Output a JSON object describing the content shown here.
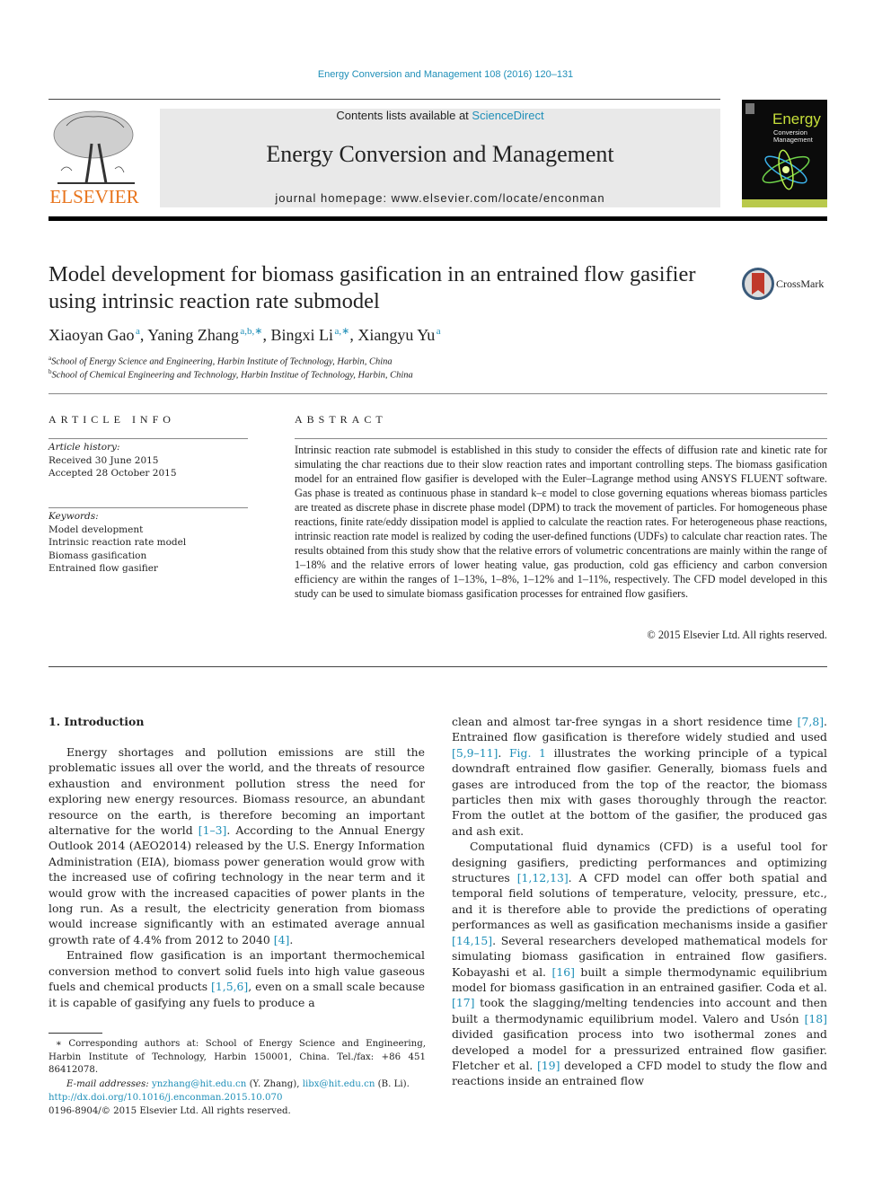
{
  "header": {
    "running_head": "Energy Conversion and Management 108 (2016) 120–131",
    "publisher_logo_text": "ELSEVIER",
    "contents_prefix": "Contents lists available at ",
    "contents_link": "ScienceDirect",
    "journal_title": "Energy Conversion and Management",
    "homepage": "journal homepage: www.elsevier.com/locate/enconman",
    "cover": {
      "line1": "Energy",
      "line2": "Conversion",
      "line3": "Management"
    },
    "crossmark_label": "CrossMark"
  },
  "article": {
    "title": "Model development for biomass gasification in an entrained flow gasifier using intrinsic reaction rate submodel",
    "authors": [
      {
        "name": "Xiaoyan Gao",
        "sup": "a"
      },
      {
        "name": "Yaning Zhang",
        "sup": "a,b,∗"
      },
      {
        "name": "Bingxi Li",
        "sup": "a,∗"
      },
      {
        "name": "Xiangyu Yu",
        "sup": "a"
      }
    ],
    "affiliations": [
      {
        "sup": "a",
        "text": "School of Energy Science and Engineering, Harbin Institute of Technology, Harbin, China"
      },
      {
        "sup": "b",
        "text": "School of Chemical Engineering and Technology, Harbin Institue of Technology, Harbin, China"
      }
    ]
  },
  "article_info": {
    "heading": "ARTICLE INFO",
    "history_label": "Article history:",
    "received": "Received 30 June 2015",
    "accepted": "Accepted 28 October 2015",
    "keywords_label": "Keywords:",
    "keywords": [
      "Model development",
      "Intrinsic reaction rate model",
      "Biomass gasification",
      "Entrained flow gasifier"
    ]
  },
  "abstract": {
    "heading": "ABSTRACT",
    "text": "Intrinsic reaction rate submodel is established in this study to consider the effects of diffusion rate and kinetic rate for simulating the char reactions due to their slow reaction rates and important controlling steps. The biomass gasification model for an entrained flow gasifier is developed with the Euler–Lagrange method using ANSYS FLUENT software. Gas phase is treated as continuous phase in standard k–ε model to close governing equations whereas biomass particles are treated as discrete phase in discrete phase model (DPM) to track the movement of particles. For homogeneous phase reactions, finite rate/eddy dissipation model is applied to calculate the reaction rates. For heterogeneous phase reactions, intrinsic reaction rate model is realized by coding the user-defined functions (UDFs) to calculate char reaction rates. The results obtained from this study show that the relative errors of volumetric concentrations are mainly within the range of 1–18% and the relative errors of lower heating value, gas production, cold gas efficiency and carbon conversion efficiency are within the ranges of 1–13%, 1–8%, 1–12% and 1–11%, respectively. The CFD model developed in this study can be used to simulate biomass gasification processes for entrained flow gasifiers.",
    "copyright": "© 2015 Elsevier Ltd. All rights reserved."
  },
  "intro": {
    "heading": "1. Introduction",
    "left": [
      {
        "t": "Energy shortages and pollution emissions are still the problematic issues all over the world, and the threats of resource exhaustion and environment pollution stress the need for exploring new energy resources. Biomass resource, an abundant resource on the earth, is therefore becoming an important alternative for the world "
      },
      {
        "ref": "[1–3]"
      },
      {
        "t": ". According to the Annual Energy Outlook 2014 (AEO2014) released by the U.S. Energy Information Administration (EIA), biomass power generation would grow with the increased use of cofiring technology in the near term and it would grow with the increased capacities of power plants in the long run. As a result, the electricity generation from biomass would increase significantly with an estimated average annual growth rate of 4.4% from 2012 to 2040 "
      },
      {
        "ref": "[4]"
      },
      {
        "t": "."
      }
    ],
    "left_p2": [
      {
        "t": "Entrained flow gasification is an important thermochemical conversion method to convert solid fuels into high value gaseous fuels and chemical products "
      },
      {
        "ref": "[1,5,6]"
      },
      {
        "t": ", even on a small scale because it is capable of gasifying any fuels to produce a"
      }
    ],
    "right_p1": [
      {
        "t": "clean and almost tar-free syngas in a short residence time "
      },
      {
        "ref": "[7,8]"
      },
      {
        "t": ". Entrained flow gasification is therefore widely studied and used "
      },
      {
        "ref": "[5,9–11]"
      },
      {
        "t": ". "
      },
      {
        "ref": "Fig. 1"
      },
      {
        "t": " illustrates the working principle of a typical downdraft entrained flow gasifier. Generally, biomass fuels and gases are introduced from the top of the reactor, the biomass particles then mix with gases thoroughly through the reactor. From the outlet at the bottom of the gasifier, the produced gas and ash exit."
      }
    ],
    "right_p2": [
      {
        "t": "Computational fluid dynamics (CFD) is a useful tool for designing gasifiers, predicting performances and optimizing structures "
      },
      {
        "ref": "[1,12,13]"
      },
      {
        "t": ". A CFD model can offer both spatial and temporal field solutions of temperature, velocity, pressure, etc., and it is therefore able to provide the predictions of operating performances as well as gasification mechanisms inside a gasifier "
      },
      {
        "ref": "[14,15]"
      },
      {
        "t": ". Several researchers developed mathematical models for simulating biomass gasification in entrained flow gasifiers. Kobayashi et al. "
      },
      {
        "ref": "[16]"
      },
      {
        "t": " built a simple thermodynamic equilibrium model for biomass gasification in an entrained gasifier. Coda et al. "
      },
      {
        "ref": "[17]"
      },
      {
        "t": " took the slagging/melting tendencies into account and then built a thermodynamic equilibrium model. Valero and Usón "
      },
      {
        "ref": "[18]"
      },
      {
        "t": " divided gasification process into two isothermal zones and developed a model for a pressurized entrained flow gasifier. Fletcher et al. "
      },
      {
        "ref": "[19]"
      },
      {
        "t": " developed a CFD model to study the flow and reactions inside an entrained flow"
      }
    ]
  },
  "footnotes": {
    "corresponding": "∗ Corresponding authors at: School of Energy Science and Engineering, Harbin Institute of Technology, Harbin 150001, China. Tel./fax: +86 451 86412078.",
    "email_label": "E-mail addresses:",
    "email1": "ynzhang@hit.edu.cn",
    "email1_who": " (Y. Zhang), ",
    "email2": "libx@hit.edu.cn",
    "email2_who": " (B. Li).",
    "doi": "http://dx.doi.org/10.1016/j.enconman.2015.10.070",
    "issn": "0196-8904/© 2015 Elsevier Ltd. All rights reserved."
  },
  "colors": {
    "link": "#1f8fb8",
    "elsevier_orange": "#e8741c",
    "banner_bg": "#e9e9e9"
  }
}
